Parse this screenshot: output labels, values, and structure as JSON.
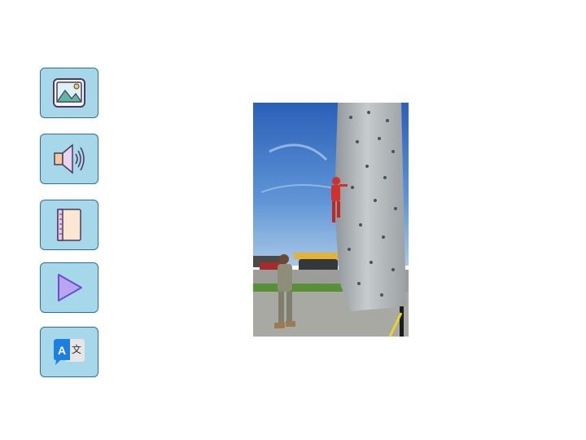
{
  "toolbar": {
    "buttons": [
      {
        "icon": "image-icon"
      },
      {
        "icon": "speaker-icon"
      },
      {
        "icon": "book-icon"
      },
      {
        "icon": "play-icon"
      },
      {
        "icon": "translate-icon",
        "glyph_latin": "A",
        "glyph_cjk": "文"
      }
    ]
  },
  "colors": {
    "button_fill": "#a6d8ea",
    "button_border": "#2a6fa3"
  }
}
